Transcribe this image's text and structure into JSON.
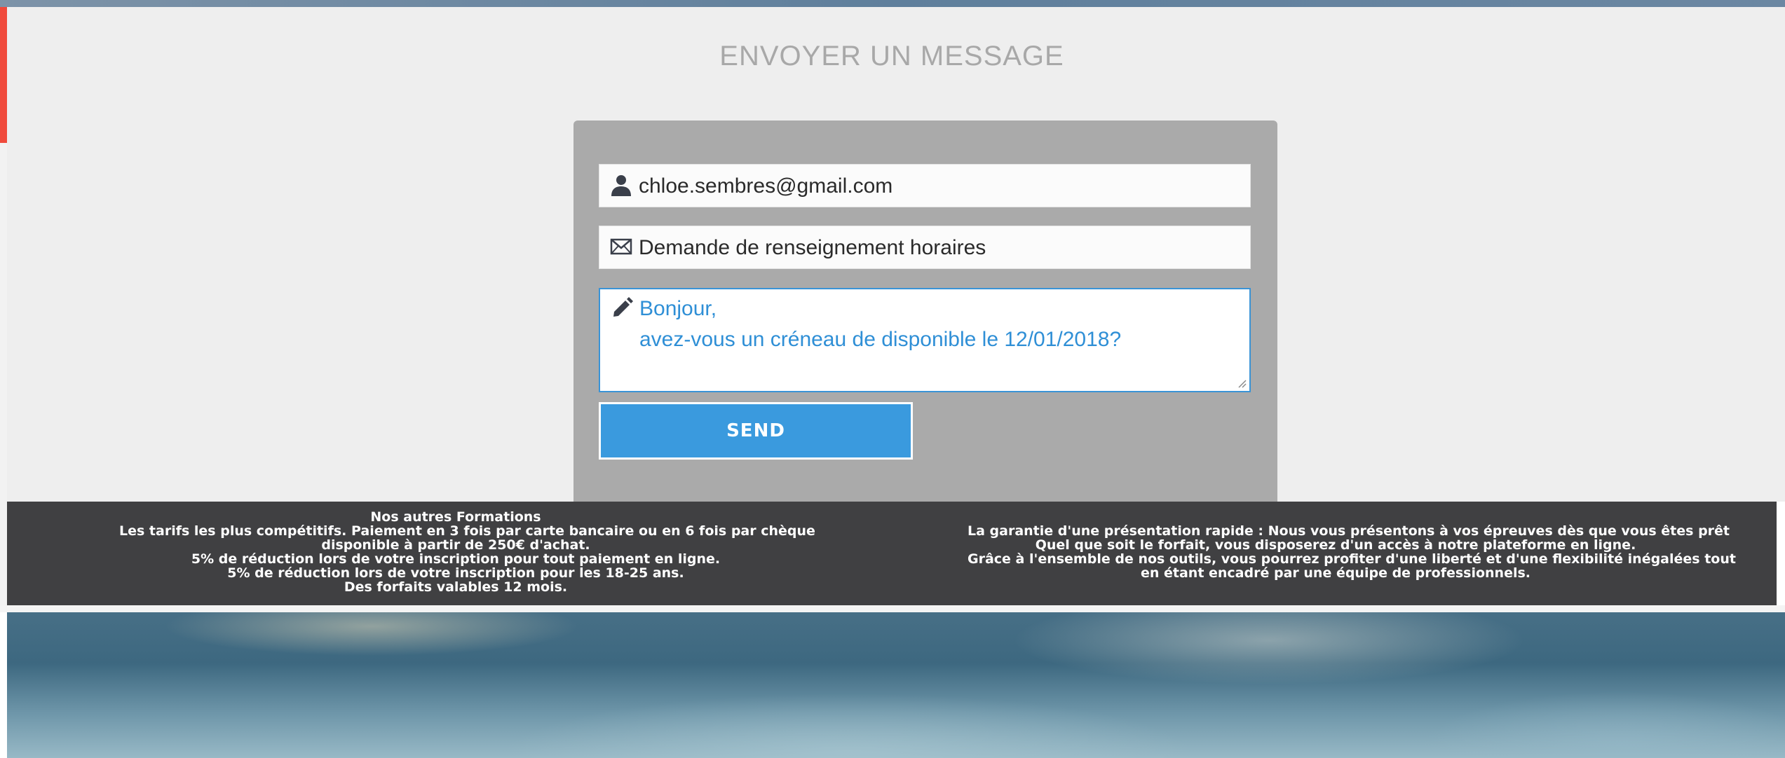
{
  "page": {
    "title": "ENVOYER UN MESSAGE"
  },
  "form": {
    "email_value": "chloe.sembres@gmail.com",
    "subject_value": "Demande de renseignement horaires",
    "message_value": "Bonjour,\navez-vous un créneau de disponible le 12/01/2018?",
    "send_label": "SEND",
    "icons": {
      "email": "user-icon",
      "subject": "envelope-icon",
      "message": "pencil-icon"
    }
  },
  "footer": {
    "left": {
      "heading": "Nos autres Formations",
      "lines": [
        "Les tarifs les plus compétitifs. Paiement en 3 fois par carte bancaire ou en 6 fois par chèque",
        "disponible à partir de 250€ d'achat.",
        "5% de réduction lors de votre inscription pour tout paiement en ligne.",
        "5% de réduction lors de votre inscription pour les 18-25 ans.",
        "Des forfaits valables 12 mois."
      ]
    },
    "right": {
      "lines": [
        "La garantie d'une présentation rapide : Nous vous présentons à vos épreuves dès que vous êtes prêt",
        "Quel que soit le forfait, vous disposerez d'un accès à notre plateforme en ligne.",
        "Grâce à l'ensemble de nos outils, vous pourrez profiter d'une liberté et d'une flexibilité inégalées tout",
        "en étant encadré par une équipe de professionnels."
      ]
    }
  },
  "colors": {
    "accent_blue": "#3a9ade",
    "message_text": "#2f8fd6",
    "card_bg": "#aaaaaa",
    "footer_bg": "#404042",
    "left_accent": "#f04a3c"
  }
}
